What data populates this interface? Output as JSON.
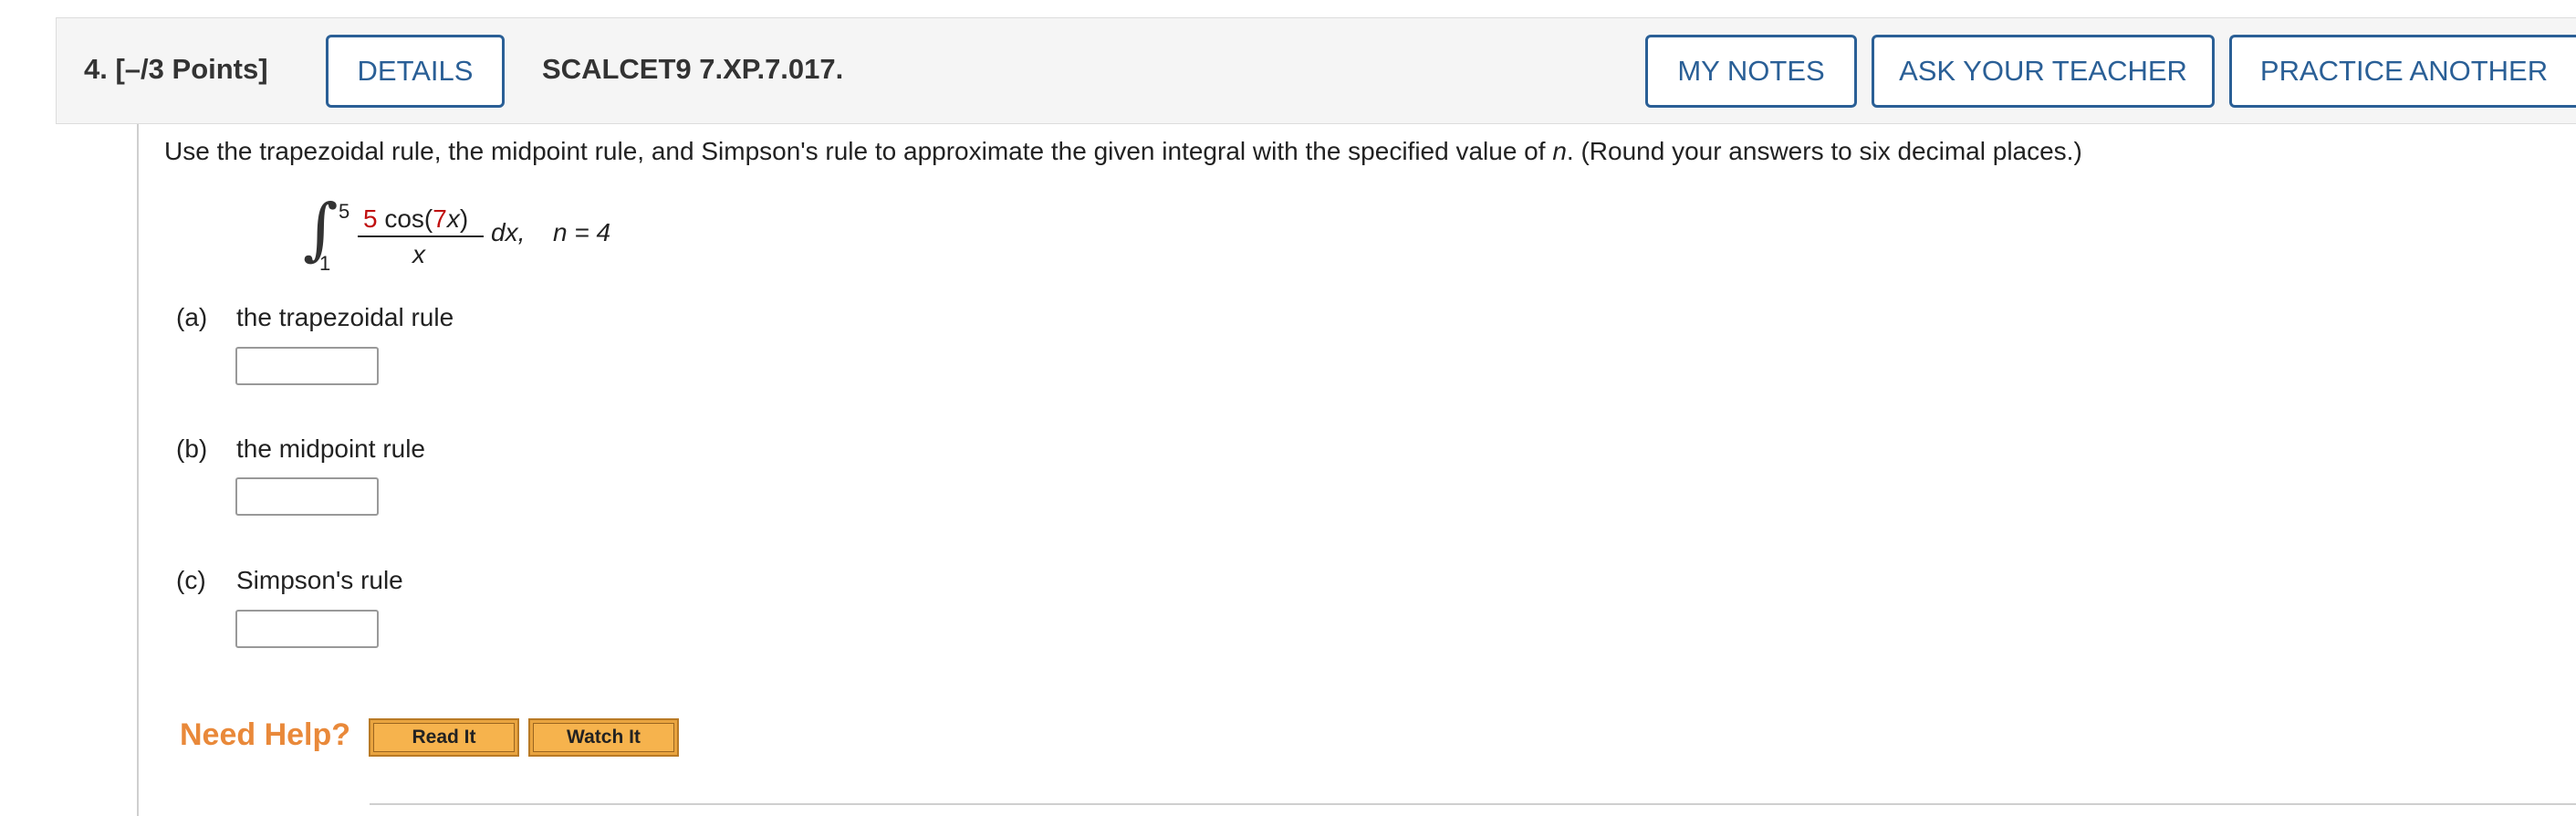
{
  "question": {
    "number": "4.",
    "points": "[–/3 Points]",
    "code": "SCALCET9 7.XP.7.017."
  },
  "header_buttons": {
    "details": "DETAILS",
    "my_notes": "MY NOTES",
    "ask_teacher": "ASK YOUR TEACHER",
    "practice": "PRACTICE ANOTHER"
  },
  "instructions": {
    "before_n": "Use the trapezoidal rule, the midpoint rule, and Simpson's rule to approximate the given integral with the specified value of ",
    "n_var": "n",
    "after_n": ". (Round your answers to six decimal places.)"
  },
  "integral": {
    "symbol": "∫",
    "upper": "5",
    "lower": "1",
    "coef": "5",
    "func_open": " cos(",
    "arg_coef": "7",
    "arg_var": "x",
    "func_close": ")",
    "denominator": "x",
    "dx": "dx,",
    "n_label": "n = 4"
  },
  "parts": [
    {
      "letter": "(a)",
      "text": "the trapezoidal rule",
      "value": ""
    },
    {
      "letter": "(b)",
      "text": "the midpoint rule",
      "value": ""
    },
    {
      "letter": "(c)",
      "text": "Simpson's rule",
      "value": ""
    }
  ],
  "help": {
    "label": "Need Help?",
    "read_it": "Read It",
    "watch_it": "Watch It"
  },
  "colors": {
    "button_blue": "#2a5f96",
    "need_help_orange": "#e9893a",
    "math_red": "#c01010"
  }
}
